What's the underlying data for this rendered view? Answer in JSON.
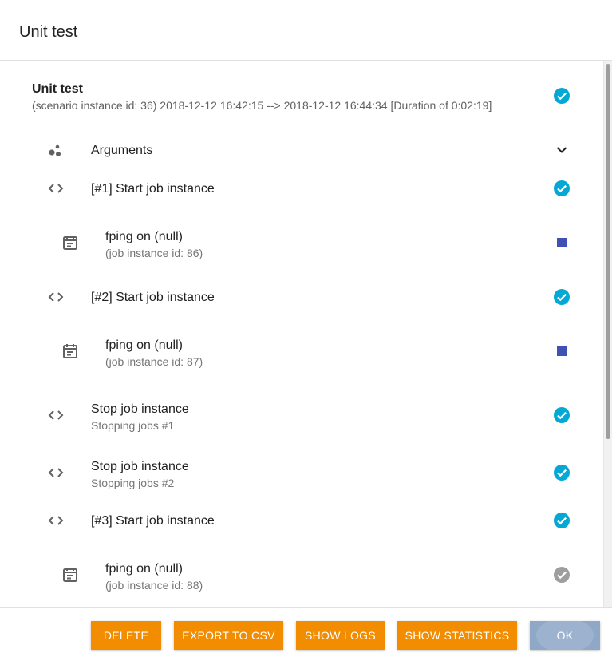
{
  "dialog": {
    "title": "Unit test"
  },
  "header": {
    "title": "Unit test",
    "subtitle": "(scenario instance id: 36) 2018-12-12 16:42:15 --> 2018-12-12 16:44:34 [Duration of 0:02:19]",
    "status_icon": "check-circle-icon"
  },
  "arguments": {
    "label": "Arguments",
    "icon": "bubbles-icon",
    "expand_icon": "chevron-down-icon"
  },
  "rows": [
    {
      "title": "[#1] Start job instance",
      "icon": "code-icon",
      "status": "check-circle-icon"
    },
    {
      "title": "fping on (null)",
      "subtitle": "(job instance id: 86)",
      "icon": "calendar-icon",
      "status": "stop-square-icon"
    },
    {
      "title": "[#2] Start job instance",
      "icon": "code-icon",
      "status": "check-circle-icon"
    },
    {
      "title": "fping on (null)",
      "subtitle": "(job instance id: 87)",
      "icon": "calendar-icon",
      "status": "stop-square-icon"
    },
    {
      "title": "Stop job instance",
      "subtitle": "Stopping jobs #1",
      "icon": "code-icon",
      "status": "check-circle-icon"
    },
    {
      "title": "Stop job instance",
      "subtitle": "Stopping jobs #2",
      "icon": "code-icon",
      "status": "check-circle-icon"
    },
    {
      "title": "[#3] Start job instance",
      "icon": "code-icon",
      "status": "check-circle-icon"
    },
    {
      "title": "fping on (null)",
      "subtitle": "(job instance id: 88)",
      "icon": "calendar-icon",
      "status": "check-circle-grey-icon"
    }
  ],
  "footer": {
    "delete_label": "DELETE",
    "export_label": "EXPORT TO CSV",
    "logs_label": "SHOW LOGS",
    "stats_label": "SHOW STATISTICS",
    "ok_label": "OK"
  },
  "colors": {
    "accent_orange": "#f28c00",
    "ok_button": "#8fa8c8",
    "success_cyan": "#03a9d4",
    "stopped_indigo": "#3f51b5",
    "finished_grey": "#9e9e9e"
  }
}
